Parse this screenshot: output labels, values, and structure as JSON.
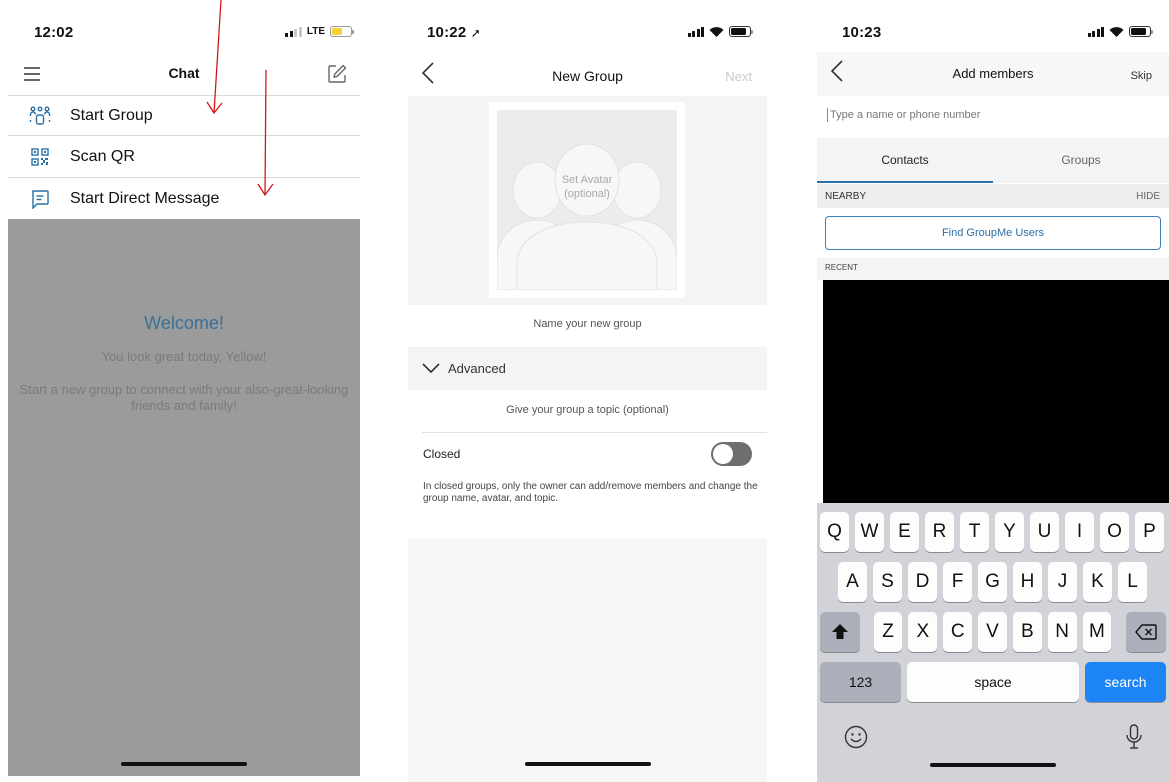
{
  "colors": {
    "accent_blue": "#2f6ea6",
    "annotation_red": "#d01818",
    "overlay_gray": "#9b9b9b",
    "welcome_blue": "#3b6f96",
    "search_key_blue": "#1c84f5",
    "battery_yellow": "#f5d431"
  },
  "panel1": {
    "status": {
      "time": "12:02",
      "network": "LTE"
    },
    "nav": {
      "title": "Chat",
      "menu_icon": "hamburger-icon",
      "compose_icon": "compose-icon"
    },
    "menu": [
      {
        "label": "Start Group",
        "icon": "group-icon"
      },
      {
        "label": "Scan QR",
        "icon": "qr-icon"
      },
      {
        "label": "Start Direct Message",
        "icon": "message-icon"
      }
    ],
    "welcome": {
      "title": "Welcome!",
      "subtitle": "You look great today, Yellow!",
      "body": "Start a new group to connect with your also-great-looking friends and family!"
    }
  },
  "panel2": {
    "status": {
      "time": "10:22"
    },
    "nav": {
      "title": "New Group",
      "next": "Next"
    },
    "avatar": {
      "line1": "Set Avatar",
      "line2": "(optional)"
    },
    "name_placeholder": "Name your new group",
    "advanced": "Advanced",
    "topic_placeholder": "Give your group a topic (optional)",
    "closed": {
      "label": "Closed",
      "on": false
    },
    "closed_help": "In closed groups, only the owner can add/remove members and change the group name, avatar, and topic."
  },
  "panel3": {
    "status": {
      "time": "10:23"
    },
    "nav": {
      "title": "Add members",
      "skip": "Skip"
    },
    "search_placeholder": "Type a name or phone number",
    "tabs": [
      "Contacts",
      "Groups"
    ],
    "nearby": {
      "label": "NEARBY",
      "action": "HIDE"
    },
    "find_button": "Find GroupMe Users",
    "recent_label": "RECENT",
    "keyboard": {
      "row1": [
        "Q",
        "W",
        "E",
        "R",
        "T",
        "Y",
        "U",
        "I",
        "O",
        "P"
      ],
      "row2": [
        "A",
        "S",
        "D",
        "F",
        "G",
        "H",
        "J",
        "K",
        "L"
      ],
      "row3": [
        "Z",
        "X",
        "C",
        "V",
        "B",
        "N",
        "M"
      ],
      "numbers": "123",
      "space": "space",
      "action": "search"
    }
  }
}
